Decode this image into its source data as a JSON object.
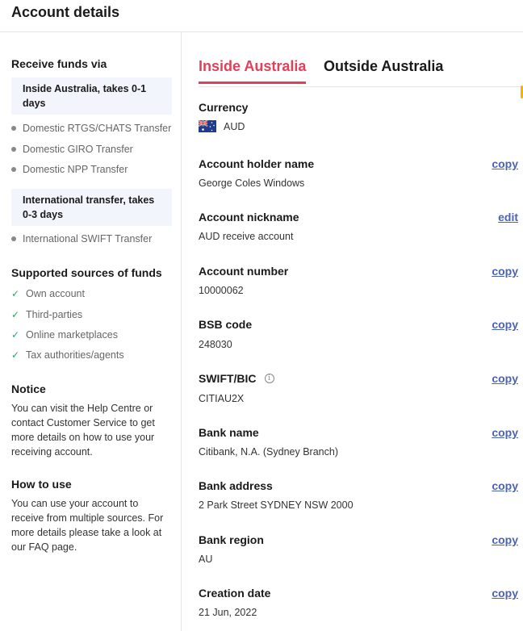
{
  "header": {
    "title": "Account details"
  },
  "sidebar": {
    "receive_title": "Receive funds via",
    "inside_box": "Inside Australia, takes 0-1 days",
    "inside_methods": [
      "Domestic RTGS/CHATS Transfer",
      "Domestic GIRO Transfer",
      "Domestic NPP Transfer"
    ],
    "intl_box": "International transfer, takes 0-3 days",
    "intl_methods": [
      "International SWIFT Transfer"
    ],
    "sources_title": "Supported sources of funds",
    "sources": [
      "Own account",
      "Third-parties",
      "Online marketplaces",
      "Tax authorities/agents"
    ],
    "notice_title": "Notice",
    "notice_text": "You can visit the Help Centre or contact Customer Service to get more details on how to use your receiving account.",
    "howto_title": "How to use",
    "howto_text": "You can use your account to receive from multiple sources. For more details please take a look at our FAQ page."
  },
  "tabs": {
    "inside": "Inside Australia",
    "outside": "Outside Australia"
  },
  "fields": {
    "currency": {
      "label": "Currency",
      "value": "AUD"
    },
    "holder": {
      "label": "Account holder name",
      "value": "George Coles Windows",
      "action": "copy"
    },
    "nickname": {
      "label": "Account nickname",
      "value": "AUD receive account",
      "action": "edit"
    },
    "number": {
      "label": "Account number",
      "value": "10000062",
      "action": "copy"
    },
    "bsb": {
      "label": "BSB code",
      "value": "248030",
      "action": "copy"
    },
    "swift": {
      "label": "SWIFT/BIC",
      "value": "CITIAU2X",
      "action": "copy"
    },
    "bank_name": {
      "label": "Bank name",
      "value": "Citibank, N.A. (Sydney Branch)",
      "action": "copy"
    },
    "bank_address": {
      "label": "Bank address",
      "value": "2 Park Street SYDNEY NSW 2000",
      "action": "copy"
    },
    "bank_region": {
      "label": "Bank region",
      "value": "AU",
      "action": "copy"
    },
    "creation_date": {
      "label": "Creation date",
      "value": "21 Jun, 2022",
      "action": "copy"
    }
  },
  "colors": {
    "accent": "#e0405a",
    "link": "#4a63b8",
    "check": "#2ba36b",
    "info_bg": "#f2f5fb"
  },
  "icons": {
    "currency_flag": "australia-flag-icon",
    "swift_info": "info-icon",
    "method_bullet": "dot",
    "source_check": "check-icon"
  }
}
